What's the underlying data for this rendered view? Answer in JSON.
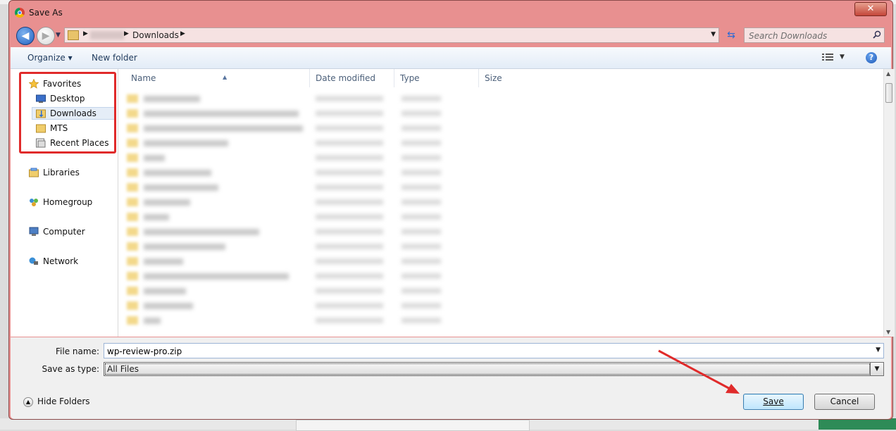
{
  "window": {
    "title": "Save As",
    "close_label": "✕"
  },
  "address": {
    "current_folder": "Downloads"
  },
  "search": {
    "placeholder": "Search Downloads"
  },
  "toolbar": {
    "organize": "Organize ▾",
    "new_folder": "New folder"
  },
  "nav": {
    "favorites": "Favorites",
    "favorites_items": [
      "Desktop",
      "Downloads",
      "MTS",
      "Recent Places"
    ],
    "libraries": "Libraries",
    "homegroup": "Homegroup",
    "computer": "Computer",
    "network": "Network"
  },
  "columns": {
    "name": "Name",
    "date": "Date modified",
    "type": "Type",
    "size": "Size"
  },
  "form": {
    "file_name_label": "File name:",
    "file_name_value": "wp-review-pro.zip",
    "save_type_label": "Save as type:",
    "save_type_value": "All Files"
  },
  "footer": {
    "hide_folders": "Hide Folders",
    "save": "Save",
    "cancel": "Cancel"
  },
  "colors": {
    "frame": "#e89090",
    "highlight": "#e02b2b",
    "arrow": "#e02b2b"
  }
}
